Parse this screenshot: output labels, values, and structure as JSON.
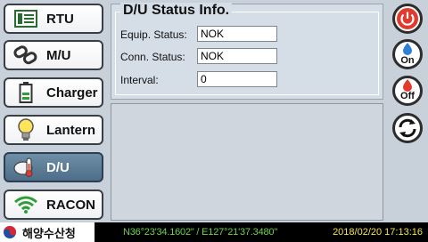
{
  "menu": [
    {
      "id": "rtu",
      "label": "RTU",
      "icon": "rtu-icon",
      "active": false
    },
    {
      "id": "mu",
      "label": "M/U",
      "icon": "link-icon",
      "active": false
    },
    {
      "id": "charger",
      "label": "Charger",
      "icon": "battery-icon",
      "active": false
    },
    {
      "id": "lantern",
      "label": "Lantern",
      "icon": "bulb-icon",
      "active": false
    },
    {
      "id": "du",
      "label": "D/U",
      "icon": "cloud-thermometer-icon",
      "active": true
    },
    {
      "id": "racon",
      "label": "RACON",
      "icon": "wifi-icon",
      "active": false
    }
  ],
  "status": {
    "title": "D/U Status Info.",
    "equip_label": "Equip. Status:",
    "equip_value": "NOK",
    "conn_label": "Conn. Status:",
    "conn_value": "NOK",
    "interval_label": "Interval:",
    "interval_value": "0"
  },
  "side_buttons": {
    "power": "power-icon",
    "on_label": "On",
    "off_label": "Off",
    "refresh": "refresh-icon"
  },
  "footer": {
    "org_name": "해양수산청",
    "coordinates": "N36°23'34.1602\" / E127°21'37.3480\"",
    "datetime": "2018/02/20 17:13:16"
  },
  "colors": {
    "accent": "#e23b2e",
    "coords": "#6cd34a",
    "datetime": "#f2e34a",
    "active_menu": "#5b7c97"
  }
}
